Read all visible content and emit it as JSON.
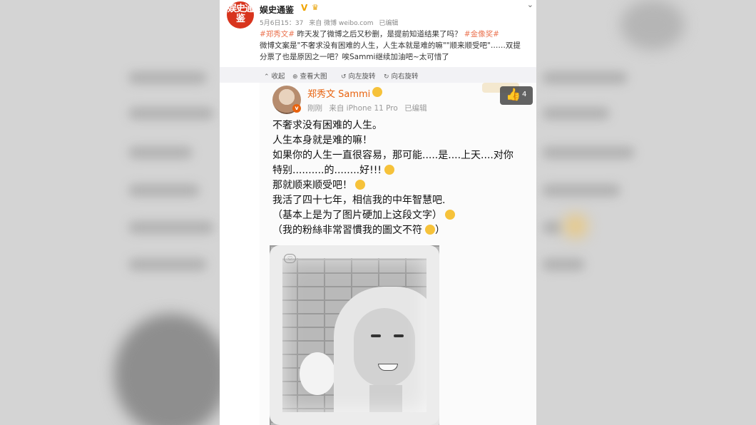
{
  "header": {
    "account_name": "娱史通鉴",
    "logo_text": "娱史通鉴",
    "verified_icon": "V",
    "crown_icon": "crown-icon",
    "meta": [
      "5月6日15：37",
      "来自 微博 weibo.com",
      "已编辑"
    ]
  },
  "post": {
    "hashtag1": "#郑秀文#",
    "line1": "昨天发了微博之后又秒删，是提前知道结果了吗？",
    "hashtag2": "#金像奖#",
    "line2": "微博文案是\"不奢求没有困难的人生，人生本就是难的嘛\"\"顺来顺受吧\"……双提",
    "line3": "分票了也是原因之一吧？唉Sammi继续加油吧~太可惜了"
  },
  "toolbar": {
    "collapse": "收起",
    "view_large": "查看大图",
    "rotate_left": "向左旋转",
    "rotate_right": "向右旋转"
  },
  "screenshot": {
    "name": "郑秀文 Sammi",
    "meta": [
      "刚刚",
      "来自 iPhone 11 Pro",
      "已编辑"
    ],
    "lines": [
      "不奢求没有困难的人生。",
      "人生本身就是难的嘛！",
      "如果你的人生一直很容易，那可能.....是....上天....对你",
      "特别..........的........好!!!",
      "那就顺来顺受吧！",
      "我活了四十七年，相信我的中年智慧吧.",
      "（基本上是为了图片硬加上这段文字）",
      "（我的粉絲非常習慣我的圖文不符"
    ],
    "closing_paren": "）"
  },
  "like": {
    "count": "4"
  },
  "colors": {
    "hashtag": "#eb7350",
    "name": "#e8620e",
    "logo": "#d8341d"
  }
}
